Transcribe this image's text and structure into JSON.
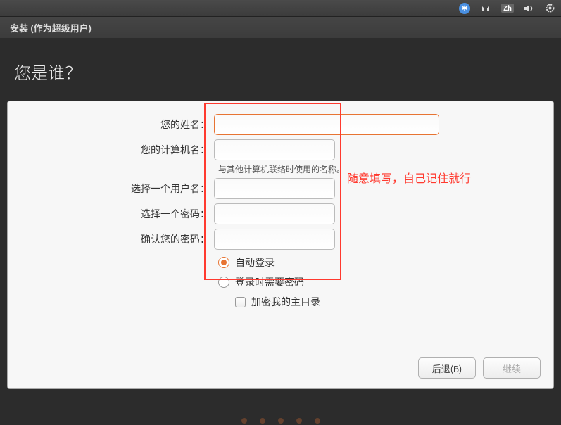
{
  "menubar": {
    "accessibility": "accessibility",
    "network": "network",
    "input_method": "Zh",
    "volume": "volume",
    "settings": "settings"
  },
  "window": {
    "title": "安装 (作为超级用户)"
  },
  "heading": "您是谁？",
  "form": {
    "name_label": "您的姓名：",
    "name_value": "",
    "computer_label": "您的计算机名：",
    "computer_value": "",
    "computer_hint": "与其他计算机联络时使用的名称。",
    "username_label": "选择一个用户名：",
    "username_value": "",
    "password_label": "选择一个密码：",
    "password_value": "",
    "confirm_label": "确认您的密码：",
    "confirm_value": "",
    "auto_login": "自动登录",
    "require_password": "登录时需要密码",
    "encrypt_home": "加密我的主目录"
  },
  "annotation": "随意填写，自己记住就行",
  "buttons": {
    "back": "后退(B)",
    "continue": "继续"
  }
}
